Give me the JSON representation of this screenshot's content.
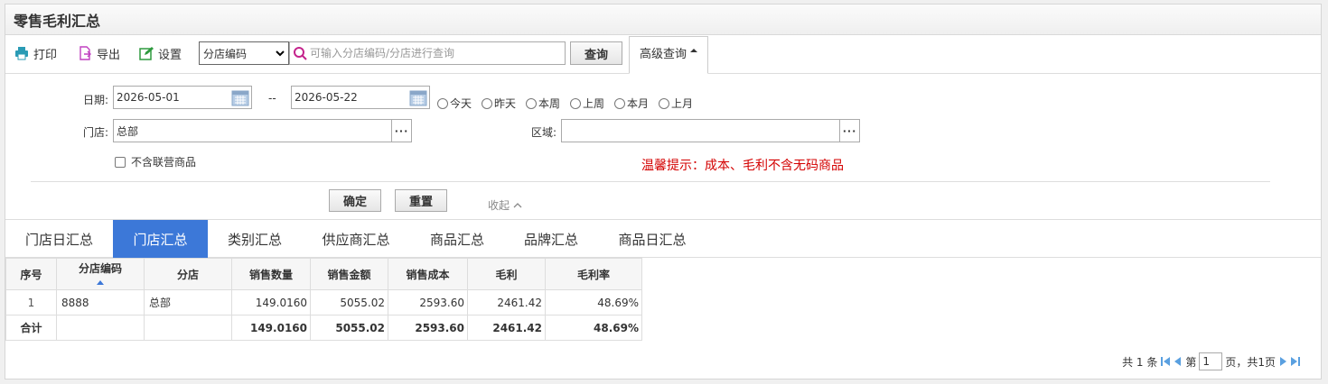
{
  "title": "零售毛利汇总",
  "toolbar": {
    "print_label": "打印",
    "export_label": "导出",
    "settings_label": "设置",
    "search_field_select": "分店编码",
    "search_placeholder": "可输入分店编码/分店进行查询",
    "query_label": "查询",
    "advanced_label": "高级查询"
  },
  "filters": {
    "date_label": "日期:",
    "date_from": "2026-05-01",
    "date_sep": "--",
    "date_to": "2026-05-22",
    "quick_dates": [
      "今天",
      "昨天",
      "本周",
      "上周",
      "本月",
      "上月"
    ],
    "store_label": "门店:",
    "store_value": "总部",
    "region_label": "区域:",
    "region_value": "",
    "exclude_joint_label": "不含联营商品",
    "tip": "温馨提示：成本、毛利不含无码商品",
    "confirm_label": "确定",
    "reset_label": "重置",
    "collapse_label": "收起"
  },
  "tabs": [
    "门店日汇总",
    "门店汇总",
    "类别汇总",
    "供应商汇总",
    "商品汇总",
    "品牌汇总",
    "商品日汇总"
  ],
  "active_tab": "门店汇总",
  "table": {
    "headers": [
      "序号",
      "分店编码",
      "分店",
      "销售数量",
      "销售金额",
      "销售成本",
      "毛利",
      "毛利率"
    ],
    "rows": [
      [
        "1",
        "8888",
        "总部",
        "149.0160",
        "5055.02",
        "2593.60",
        "2461.42",
        "48.69%"
      ]
    ],
    "total": [
      "合计",
      "",
      "",
      "149.0160",
      "5055.02",
      "2593.60",
      "2461.42",
      "48.69%"
    ]
  },
  "pager": {
    "total_text": "共 1 条",
    "page_prefix": "第",
    "page_value": "1",
    "page_suffix": "页，共1页"
  },
  "colors": {
    "accent": "#3c78d8",
    "tip": "#d40000"
  }
}
